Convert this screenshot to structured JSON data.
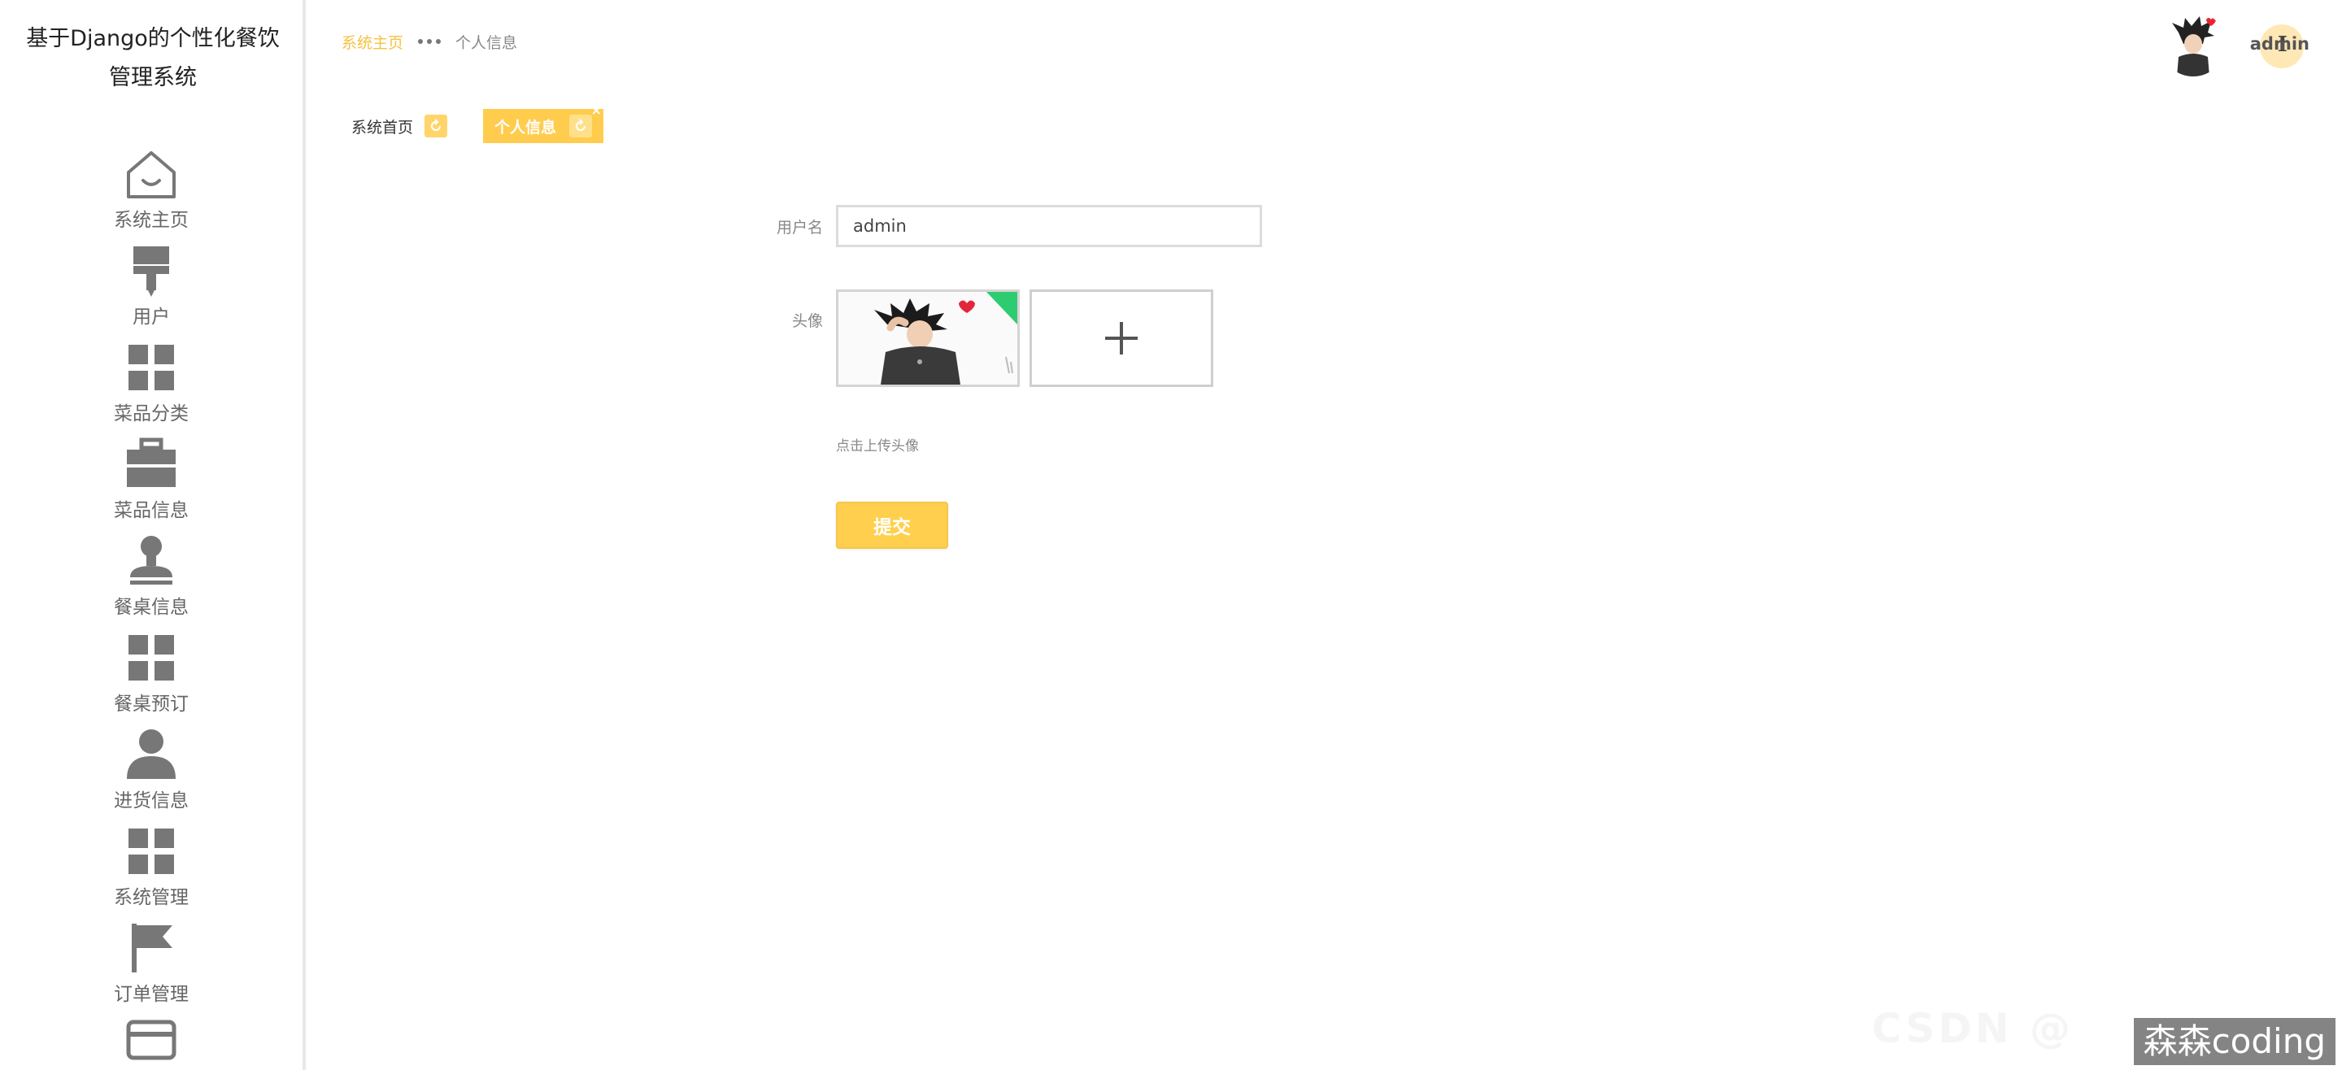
{
  "app": {
    "title": "基于Django的个性化餐饮管理系统"
  },
  "sidebar": {
    "items": [
      {
        "label": "系统主页",
        "icon": "home-icon"
      },
      {
        "label": "用户",
        "icon": "user-brush-icon"
      },
      {
        "label": "菜品分类",
        "icon": "grid-icon"
      },
      {
        "label": "菜品信息",
        "icon": "briefcase-icon"
      },
      {
        "label": "餐桌信息",
        "icon": "stamp-icon"
      },
      {
        "label": "餐桌预订",
        "icon": "grid-icon"
      },
      {
        "label": "进货信息",
        "icon": "person-icon"
      },
      {
        "label": "系统管理",
        "icon": "grid-icon"
      },
      {
        "label": "订单管理",
        "icon": "flag-icon"
      },
      {
        "label": "",
        "icon": "card-icon"
      }
    ]
  },
  "header": {
    "breadcrumb_home": "系统主页",
    "breadcrumb_current": "个人信息",
    "username": "admin"
  },
  "tabs": [
    {
      "label": "系统首页",
      "active": false
    },
    {
      "label": "个人信息",
      "active": true,
      "close": "×"
    }
  ],
  "form": {
    "username_label": "用户名",
    "username_value": "admin",
    "avatar_label": "头像",
    "upload_hint": "点击上传头像",
    "submit_label": "提交"
  },
  "watermark": {
    "text": "森森coding",
    "faint_text": "CSDN @"
  },
  "colors": {
    "accent": "#ffcc4d",
    "breadcrumb_active": "#f5c242",
    "icon_gray": "#777777"
  }
}
